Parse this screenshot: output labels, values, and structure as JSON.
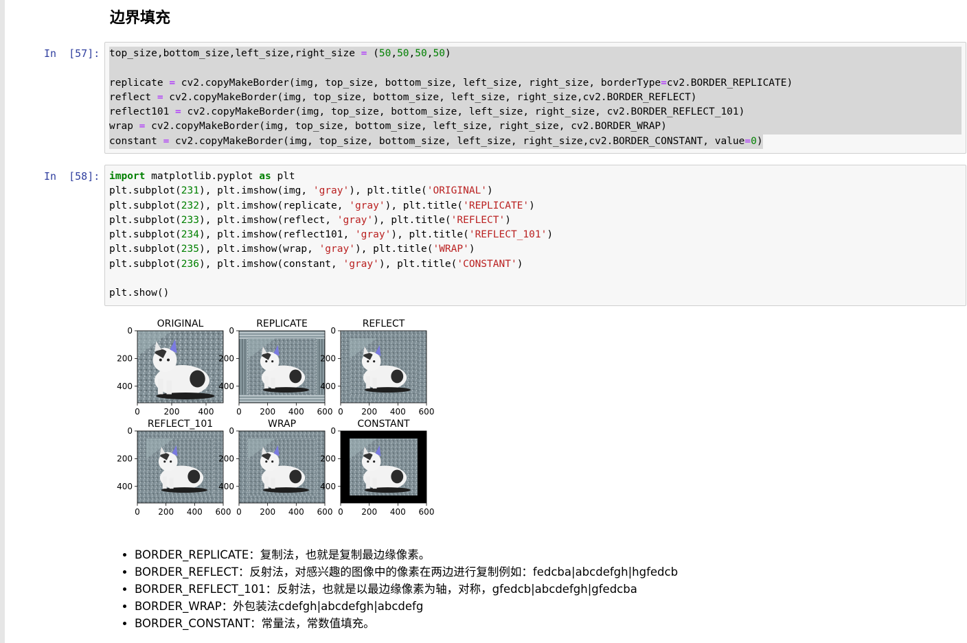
{
  "heading": "边界填充",
  "cells": [
    {
      "prompt": "In  [57]:",
      "lines": [
        [
          {
            "t": "top_size,bottom_size,left_size,right_size ",
            "c": ""
          },
          {
            "t": "=",
            "c": "op"
          },
          {
            "t": " (",
            "c": ""
          },
          {
            "t": "50",
            "c": "num"
          },
          {
            "t": ",",
            "c": ""
          },
          {
            "t": "50",
            "c": "num"
          },
          {
            "t": ",",
            "c": ""
          },
          {
            "t": "50",
            "c": "num"
          },
          {
            "t": ",",
            "c": ""
          },
          {
            "t": "50",
            "c": "num"
          },
          {
            "t": ")",
            "c": ""
          }
        ],
        [],
        [
          {
            "t": "replicate ",
            "c": ""
          },
          {
            "t": "=",
            "c": "op"
          },
          {
            "t": " cv2.copyMakeBorder(img, top_size, bottom_size, left_size, right_size, borderType",
            "c": ""
          },
          {
            "t": "=",
            "c": "op"
          },
          {
            "t": "cv2.BORDER_REPLICATE)",
            "c": ""
          }
        ],
        [
          {
            "t": "reflect ",
            "c": ""
          },
          {
            "t": "=",
            "c": "op"
          },
          {
            "t": " cv2.copyMakeBorder(img, top_size, bottom_size, left_size, right_size,cv2.BORDER_REFLECT)",
            "c": ""
          }
        ],
        [
          {
            "t": "reflect101 ",
            "c": ""
          },
          {
            "t": "=",
            "c": "op"
          },
          {
            "t": " cv2.copyMakeBorder(img, top_size, bottom_size, left_size, right_size, cv2.BORDER_REFLECT_101)",
            "c": ""
          }
        ],
        [
          {
            "t": "wrap ",
            "c": ""
          },
          {
            "t": "=",
            "c": "op"
          },
          {
            "t": " cv2.copyMakeBorder(img, top_size, bottom_size, left_size, right_size, cv2.BORDER_WRAP)",
            "c": ""
          }
        ],
        [
          {
            "t": "constant ",
            "c": ""
          },
          {
            "t": "=",
            "c": "op"
          },
          {
            "t": " cv2.copyMakeBorder(img, top_size, bottom_size, left_size, right_size,cv2.BORDER_CONSTANT, value",
            "c": ""
          },
          {
            "t": "=",
            "c": "op"
          },
          {
            "t": "0",
            "c": "num"
          },
          {
            "t": ")",
            "c": ""
          }
        ]
      ]
    },
    {
      "prompt": "In  [58]:",
      "lines": [
        [
          {
            "t": "import",
            "c": "kw"
          },
          {
            "t": " matplotlib.pyplot ",
            "c": ""
          },
          {
            "t": "as",
            "c": "kw"
          },
          {
            "t": " plt",
            "c": ""
          }
        ],
        [
          {
            "t": "plt.subplot(",
            "c": ""
          },
          {
            "t": "231",
            "c": "num"
          },
          {
            "t": "), plt.imshow(img, ",
            "c": ""
          },
          {
            "t": "'gray'",
            "c": "str"
          },
          {
            "t": "), plt.title(",
            "c": ""
          },
          {
            "t": "'ORIGINAL'",
            "c": "str"
          },
          {
            "t": ")",
            "c": ""
          }
        ],
        [
          {
            "t": "plt.subplot(",
            "c": ""
          },
          {
            "t": "232",
            "c": "num"
          },
          {
            "t": "), plt.imshow(replicate, ",
            "c": ""
          },
          {
            "t": "'gray'",
            "c": "str"
          },
          {
            "t": "), plt.title(",
            "c": ""
          },
          {
            "t": "'REPLICATE'",
            "c": "str"
          },
          {
            "t": ")",
            "c": ""
          }
        ],
        [
          {
            "t": "plt.subplot(",
            "c": ""
          },
          {
            "t": "233",
            "c": "num"
          },
          {
            "t": "), plt.imshow(reflect, ",
            "c": ""
          },
          {
            "t": "'gray'",
            "c": "str"
          },
          {
            "t": "), plt.title(",
            "c": ""
          },
          {
            "t": "'REFLECT'",
            "c": "str"
          },
          {
            "t": ")",
            "c": ""
          }
        ],
        [
          {
            "t": "plt.subplot(",
            "c": ""
          },
          {
            "t": "234",
            "c": "num"
          },
          {
            "t": "), plt.imshow(reflect101, ",
            "c": ""
          },
          {
            "t": "'gray'",
            "c": "str"
          },
          {
            "t": "), plt.title(",
            "c": ""
          },
          {
            "t": "'REFLECT_101'",
            "c": "str"
          },
          {
            "t": ")",
            "c": ""
          }
        ],
        [
          {
            "t": "plt.subplot(",
            "c": ""
          },
          {
            "t": "235",
            "c": "num"
          },
          {
            "t": "), plt.imshow(wrap, ",
            "c": ""
          },
          {
            "t": "'gray'",
            "c": "str"
          },
          {
            "t": "), plt.title(",
            "c": ""
          },
          {
            "t": "'WRAP'",
            "c": "str"
          },
          {
            "t": ")",
            "c": ""
          }
        ],
        [
          {
            "t": "plt.subplot(",
            "c": ""
          },
          {
            "t": "236",
            "c": "num"
          },
          {
            "t": "), plt.imshow(constant, ",
            "c": ""
          },
          {
            "t": "'gray'",
            "c": "str"
          },
          {
            "t": "), plt.title(",
            "c": ""
          },
          {
            "t": "'CONSTANT'",
            "c": "str"
          },
          {
            "t": ")",
            "c": ""
          }
        ],
        [],
        [
          {
            "t": "plt.show()",
            "c": ""
          }
        ]
      ]
    }
  ],
  "figure": {
    "panels": [
      {
        "title": "ORIGINAL",
        "yticks": [
          "0",
          "200",
          "400"
        ],
        "xticks": [
          "0",
          "200",
          "400"
        ],
        "border": "none"
      },
      {
        "title": "REPLICATE",
        "yticks": [
          "0",
          "200",
          "400"
        ],
        "xticks": [
          "0",
          "200",
          "400",
          "600"
        ],
        "border": "replicate"
      },
      {
        "title": "REFLECT",
        "yticks": [
          "0",
          "200",
          "400"
        ],
        "xticks": [
          "0",
          "200",
          "400",
          "600"
        ],
        "border": "reflect"
      },
      {
        "title": "REFLECT_101",
        "yticks": [
          "0",
          "200",
          "400"
        ],
        "xticks": [
          "0",
          "200",
          "400",
          "600"
        ],
        "border": "reflect"
      },
      {
        "title": "WRAP",
        "yticks": [
          "0",
          "200",
          "400"
        ],
        "xticks": [
          "0",
          "200",
          "400",
          "600"
        ],
        "border": "wrap"
      },
      {
        "title": "CONSTANT",
        "yticks": [
          "0",
          "200",
          "400"
        ],
        "xticks": [
          "0",
          "200",
          "400",
          "600"
        ],
        "border": "constant"
      }
    ]
  },
  "bullets": [
    "BORDER_REPLICATE：复制法，也就是复制最边缘像素。",
    "BORDER_REFLECT：反射法，对感兴趣的图像中的像素在两边进行复制例如：fedcba|abcdefgh|hgfedcb",
    "BORDER_REFLECT_101：反射法，也就是以最边缘像素为轴，对称，gfedcb|abcdefgh|gfedcba",
    "BORDER_WRAP：外包装法cdefgh|abcdefgh|abcdefg",
    "BORDER_CONSTANT：常量法，常数值填充。"
  ],
  "colors": {
    "prompt": "#303f9f",
    "keyword": "#008000",
    "number": "#008000",
    "string": "#ba2121",
    "operator": "#aa22ff",
    "cell_bg": "#f7f7f7",
    "selection": "#d7d7d7"
  }
}
